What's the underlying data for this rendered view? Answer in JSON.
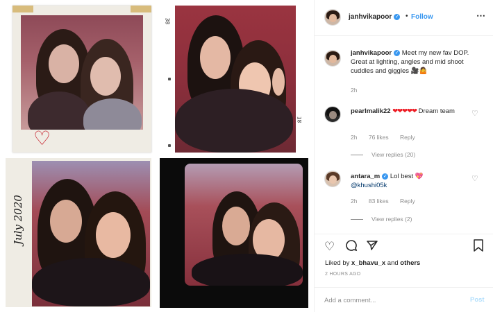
{
  "header": {
    "username": "janhvikapoor",
    "verified_icon": "verified-badge-icon",
    "separator": "•",
    "follow_label": "Follow",
    "more_icon": "more-options-icon"
  },
  "caption": {
    "username": "janhvikapoor",
    "text": "Meet my new fav DOP. Great at lighting, angles and mid shoot cuddles and giggles 🎥🤷",
    "time": "2h"
  },
  "comments": [
    {
      "username": "pearlmalik22",
      "hearts": "❤❤❤❤❤",
      "text": "Dream team",
      "time": "2h",
      "likes": "76 likes",
      "reply_label": "Reply",
      "view_replies": "View replies (20)"
    },
    {
      "username": "antara_m",
      "text": "Lol best 💖",
      "mention": "@khushi05k",
      "time": "2h",
      "likes": "83 likes",
      "reply_label": "Reply",
      "view_replies": "View replies (2)"
    }
  ],
  "actions": {
    "like_icon": "heart-outline-icon",
    "comment_icon": "comment-bubble-icon",
    "share_icon": "paper-plane-icon",
    "save_icon": "bookmark-icon",
    "liked_by_prefix": "Liked by",
    "liked_by_user": "x_bhavu_x",
    "liked_by_and": "and",
    "liked_by_others": "others",
    "date": "2 HOURS AGO"
  },
  "comment_box": {
    "placeholder": "Add a comment...",
    "post_label": "Post"
  },
  "collage": {
    "frame_number_top": "38",
    "frame_number_bottom": "18",
    "side_label": "July 2020",
    "doodle_icon": "heart-doodle-icon"
  },
  "colors": {
    "accent_blue": "#3897f0",
    "post_disabled": "#b2dffc",
    "muted_text": "#8e8e8e",
    "heart_red": "#ed1c24"
  }
}
